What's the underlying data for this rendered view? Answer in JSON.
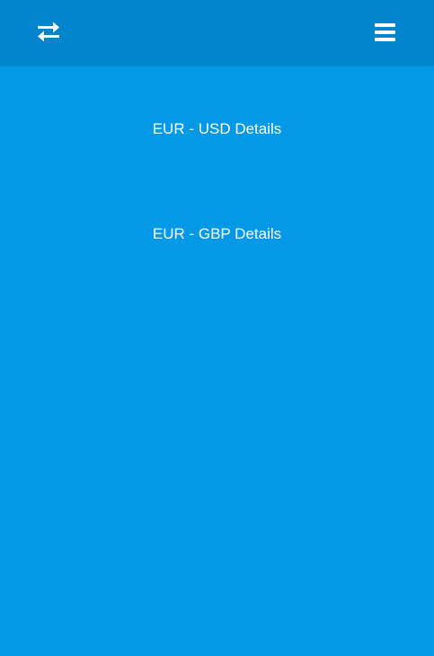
{
  "header": {
    "left_icon": "swap-arrows-icon",
    "right_icon": "hamburger-menu-icon",
    "colors": {
      "bar": "#0385ce",
      "background": "#0399e6",
      "text": "#ffffff"
    }
  },
  "main": {
    "links": [
      {
        "label": "EUR - USD Details"
      },
      {
        "label": "EUR - GBP Details"
      }
    ]
  }
}
